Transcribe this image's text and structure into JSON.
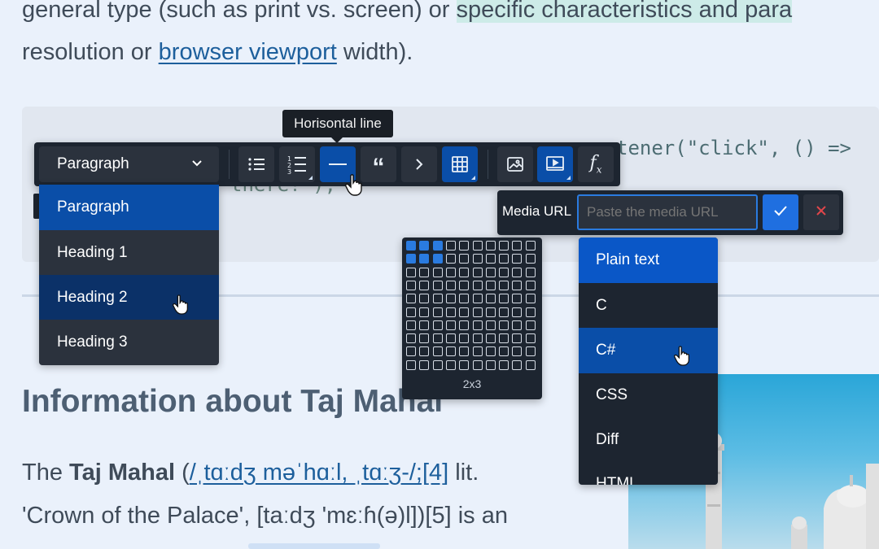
{
  "article": {
    "line1_a": "general type (such as print vs. screen) or ",
    "line1_highlight": "specific characteristics and para",
    "line2_a": "resolution or ",
    "line2_link": "browser viewport",
    "line2_b": " width).",
    "code_line1": "document.getElementById(\"hello\").addEventListener(\"click\", () =>",
    "code_line1_visible": "tener(\"click\", () =>",
    "code_line2": "there!\");",
    "heading": "Information about Taj Mahal",
    "p1_a": "The ",
    "p1_bold": "Taj Mahal",
    "p1_space": " (",
    "p1_link": "/ˌtɑːdʒ məˈhɑːl, ˌtɑːʒ-/;[4]",
    "p1_b": " lit.",
    "p2": "'Crown of the Palace', [taːdʒ 'mɛːɦ(ə)l])[5] is an"
  },
  "tooltip": {
    "text": "Horisontal line"
  },
  "toolbar": {
    "heading_select": "Paragraph",
    "buttons": [
      "bulleted-list",
      "numbered-list",
      "horizontal-line",
      "block-quote",
      "code-block",
      "insert-table",
      "insert-image",
      "insert-media",
      "formula"
    ]
  },
  "heading_menu": {
    "items": [
      "Paragraph",
      "Heading 1",
      "Heading 2",
      "Heading 3"
    ],
    "selected": "Paragraph",
    "hovered": "Heading 2"
  },
  "media": {
    "label": "Media URL",
    "placeholder": "Paste the media URL"
  },
  "table_grid": {
    "rows": 10,
    "cols": 10,
    "selected_rows": 2,
    "selected_cols": 3,
    "size_label": "2x3"
  },
  "code_languages": {
    "items": [
      "Plain text",
      "C",
      "C#",
      "CSS",
      "Diff",
      "HTML"
    ],
    "selected": "Plain text",
    "hovered": "C#"
  },
  "colors": {
    "accent": "#0a4ea8",
    "toolbar_bg": "#1d2530",
    "page_bg": "#eaf1fb",
    "confirm": "#1f6fe0",
    "cancel_icon": "#e0464b"
  }
}
